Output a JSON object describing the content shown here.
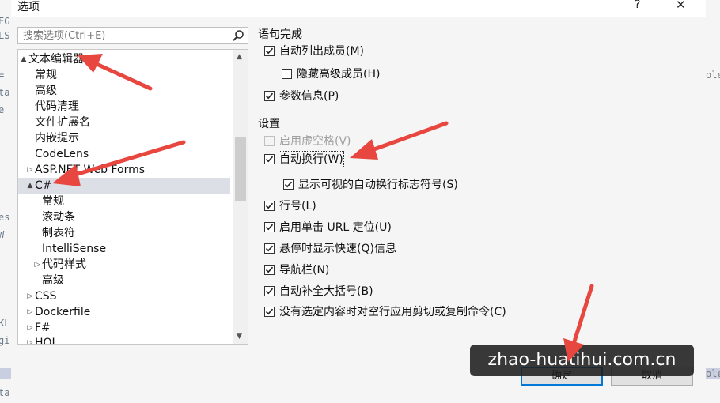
{
  "background": {
    "left_fragments": [
      "EG",
      "LS",
      "=",
      "ta",
      "e",
      "es",
      "W",
      "KL",
      "gi",
      "ta"
    ],
    "right_fragments": [
      "ole",
      "ole"
    ]
  },
  "dialog": {
    "title": "选项",
    "help_label": "?",
    "close_label": "✕"
  },
  "search": {
    "placeholder": "搜索选项(Ctrl+E)"
  },
  "tree": {
    "items": [
      {
        "label": "文本编辑器",
        "expander": "▲"
      },
      {
        "label": "常规",
        "expander": ""
      },
      {
        "label": "高级",
        "expander": ""
      },
      {
        "label": "代码清理",
        "expander": ""
      },
      {
        "label": "文件扩展名",
        "expander": ""
      },
      {
        "label": "内嵌提示",
        "expander": ""
      },
      {
        "label": "CodeLens",
        "expander": ""
      },
      {
        "label": "ASP.NET Web Forms",
        "expander": "▷"
      },
      {
        "label": "C#",
        "expander": "▲"
      },
      {
        "label": "常规",
        "expander": ""
      },
      {
        "label": "滚动条",
        "expander": ""
      },
      {
        "label": "制表符",
        "expander": ""
      },
      {
        "label": "IntelliSense",
        "expander": ""
      },
      {
        "label": "代码样式",
        "expander": "▷"
      },
      {
        "label": "高级",
        "expander": ""
      },
      {
        "label": "CSS",
        "expander": "▷"
      },
      {
        "label": "Dockerfile",
        "expander": "▷"
      },
      {
        "label": "F#",
        "expander": "▷"
      },
      {
        "label": "HQL",
        "expander": "▷"
      }
    ],
    "selected": "C#",
    "scroll_up": "▲",
    "scroll_down": "▼"
  },
  "statement_completion": {
    "heading": "语句完成",
    "auto_list_members": {
      "label": "自动列出成员(M)",
      "checked": true
    },
    "hide_advanced_members": {
      "label": "隐藏高级成员(H)",
      "checked": false
    },
    "parameter_info": {
      "label": "参数信息(P)",
      "checked": true
    }
  },
  "settings": {
    "heading": "设置",
    "virtual_space": {
      "label": "启用虚空格(V)",
      "checked": false,
      "enabled": false
    },
    "word_wrap": {
      "label": "自动换行(W)",
      "checked": true
    },
    "show_wrap_glyphs": {
      "label": "显示可视的自动换行标志符号(S)",
      "checked": true
    },
    "line_numbers": {
      "label": "行号(L)",
      "checked": true
    },
    "single_click_url": {
      "label": "启用单击 URL 定位(U)",
      "checked": true
    },
    "quick_info_hover": {
      "label": "悬停时显示快速(Q)信息",
      "checked": true
    },
    "navigation_bar": {
      "label": "导航栏(N)",
      "checked": true
    },
    "auto_brace": {
      "label": "自动补全大括号(B)",
      "checked": true
    },
    "cut_copy_blank": {
      "label": "没有选定内容时对空行应用剪切或复制命令(C)",
      "checked": true
    }
  },
  "buttons": {
    "ok": "确定",
    "cancel": "取消"
  },
  "watermark": "zhao-huatihui.com.cn",
  "colors": {
    "annotation_arrow": "#e8473f",
    "selection": "#dcdfe6",
    "ok_border": "#0078d7"
  }
}
